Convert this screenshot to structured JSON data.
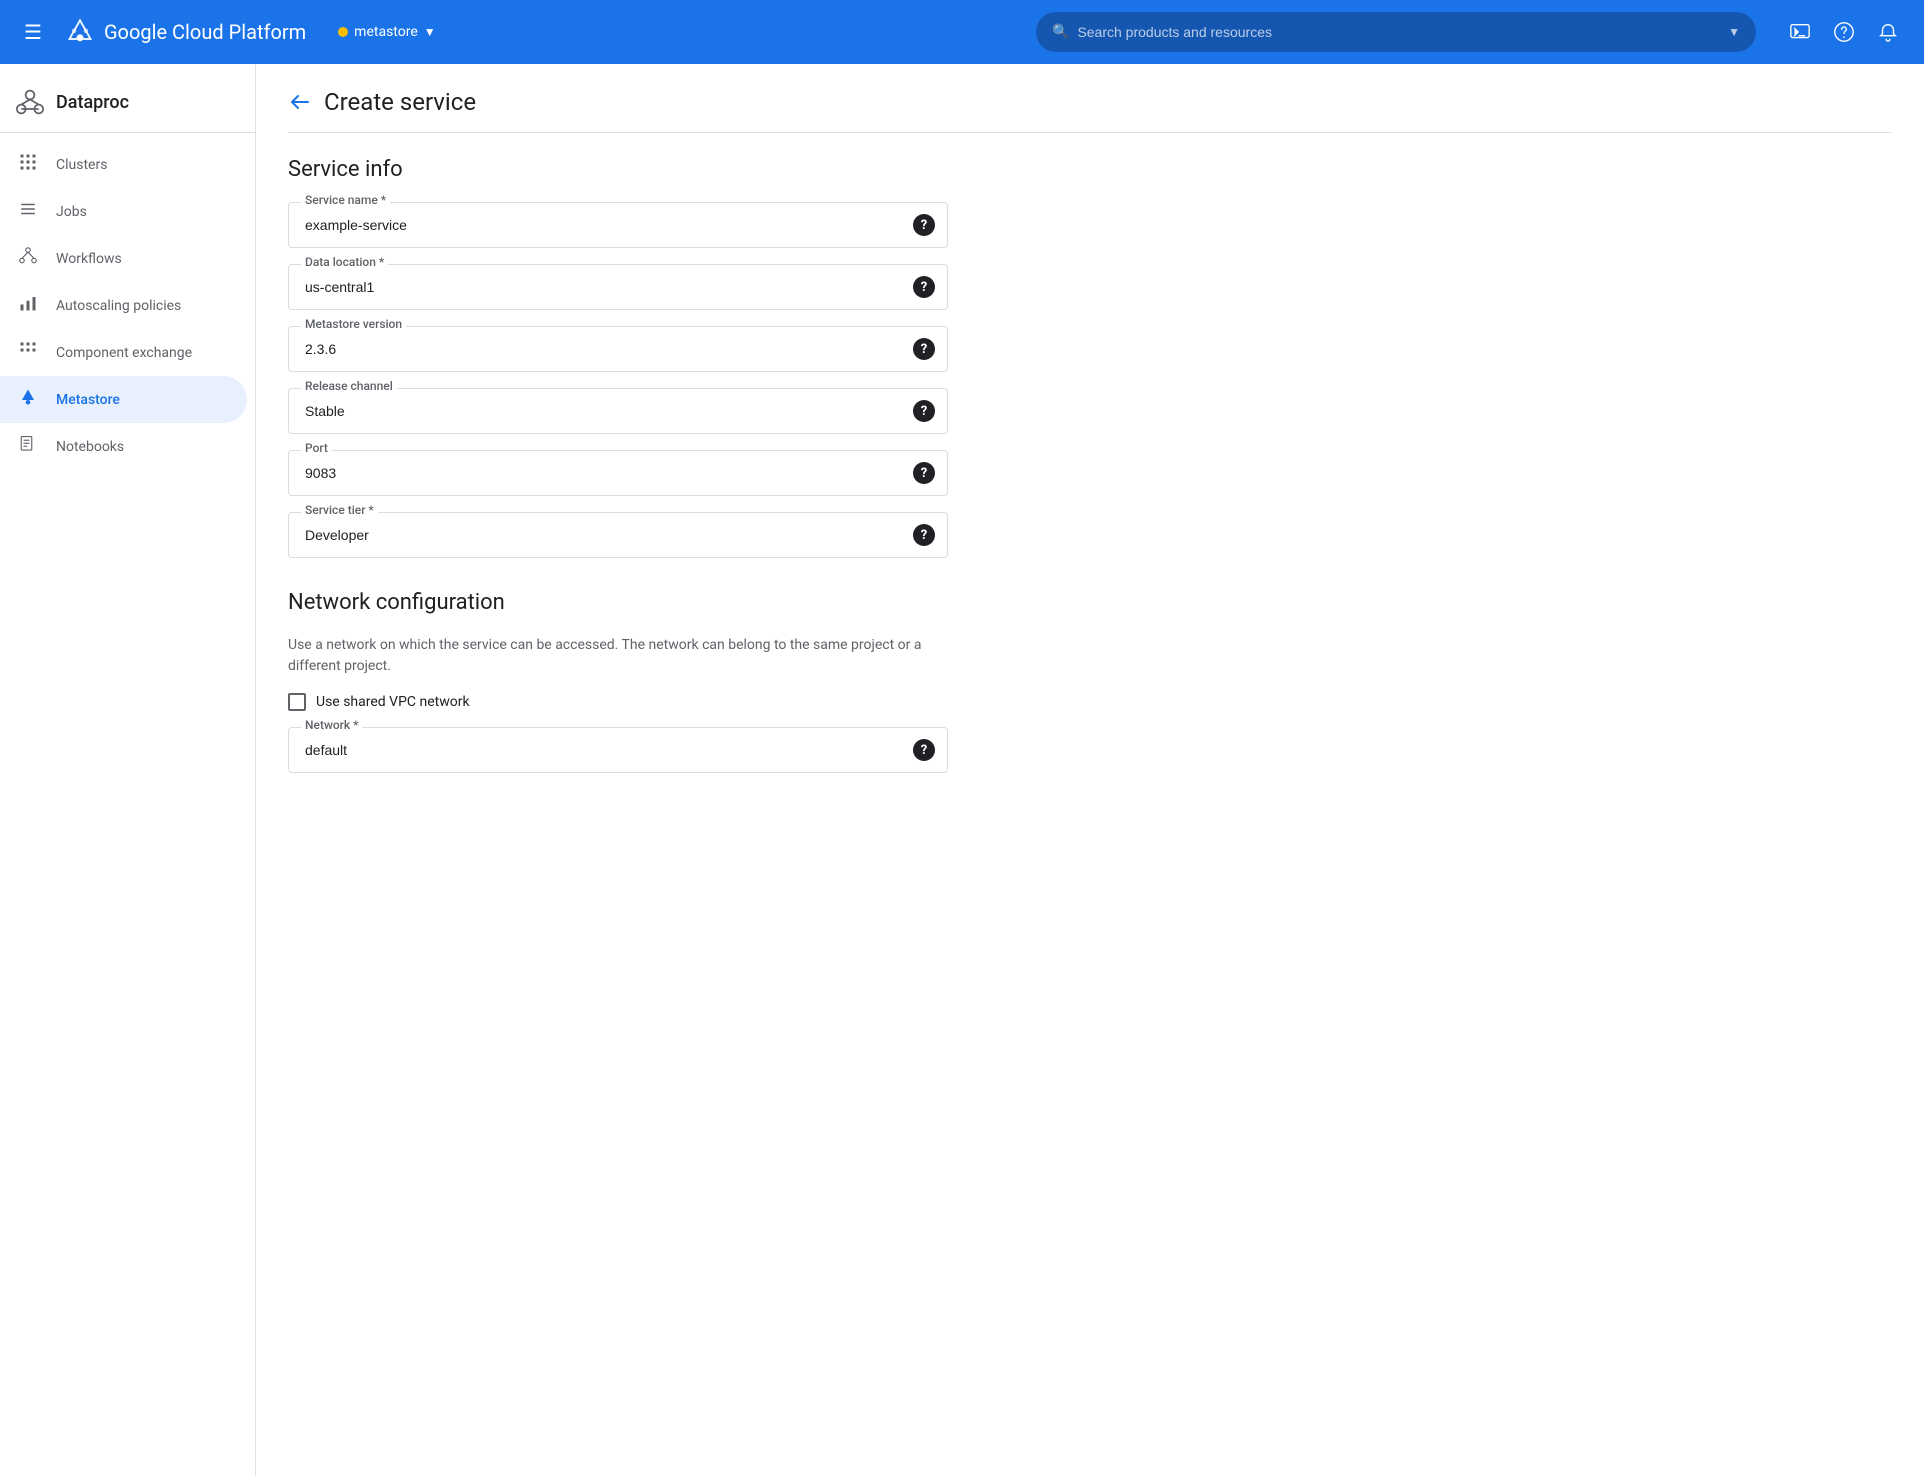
{
  "topnav": {
    "menu_icon": "☰",
    "logo_text": "Google Cloud Platform",
    "project_name": "metastore",
    "search_placeholder": "Search products and resources"
  },
  "sidebar": {
    "app_name": "Dataproc",
    "items": [
      {
        "id": "clusters",
        "label": "Clusters",
        "icon": "⊞"
      },
      {
        "id": "jobs",
        "label": "Jobs",
        "icon": "≡"
      },
      {
        "id": "workflows",
        "label": "Workflows",
        "icon": "⬡"
      },
      {
        "id": "autoscaling",
        "label": "Autoscaling policies",
        "icon": "▥"
      },
      {
        "id": "component-exchange",
        "label": "Component exchange",
        "icon": "⊞"
      },
      {
        "id": "metastore",
        "label": "Metastore",
        "icon": "◆",
        "active": true
      },
      {
        "id": "notebooks",
        "label": "Notebooks",
        "icon": "☰"
      }
    ]
  },
  "page": {
    "back_label": "←",
    "title": "Create service"
  },
  "form": {
    "service_info_title": "Service info",
    "fields": [
      {
        "id": "service-name",
        "label": "Service name *",
        "value": "example-service",
        "type": "input",
        "has_dropdown": false,
        "has_help": true
      },
      {
        "id": "data-location",
        "label": "Data location *",
        "value": "us-central1",
        "type": "select",
        "has_dropdown": true,
        "has_help": true
      },
      {
        "id": "metastore-version",
        "label": "Metastore version",
        "value": "2.3.6",
        "type": "select",
        "has_dropdown": true,
        "has_help": true
      },
      {
        "id": "release-channel",
        "label": "Release channel",
        "value": "Stable",
        "type": "select",
        "has_dropdown": true,
        "has_help": true
      },
      {
        "id": "port",
        "label": "Port",
        "value": "9083",
        "type": "input",
        "has_dropdown": false,
        "has_help": true
      },
      {
        "id": "service-tier",
        "label": "Service tier *",
        "value": "Developer",
        "type": "select",
        "has_dropdown": true,
        "has_help": true
      }
    ],
    "network_title": "Network configuration",
    "network_desc": "Use a network on which the service can be accessed. The network can belong to the same project or a different project.",
    "vpc_checkbox_label": "Use shared VPC network",
    "network_field": {
      "id": "network",
      "label": "Network *",
      "value": "default",
      "type": "select",
      "has_dropdown": true,
      "has_help": true
    }
  }
}
